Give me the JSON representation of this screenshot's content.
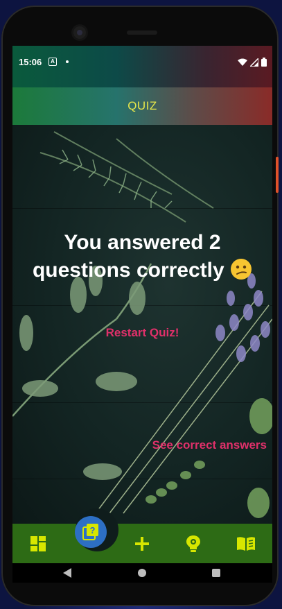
{
  "status_bar": {
    "time": "15:06",
    "notification_icon": "A"
  },
  "app_bar": {
    "title": "QUIZ"
  },
  "result": {
    "message": "You answered 2 questions correctly",
    "emoji_name": "confused-face-emoji"
  },
  "actions": {
    "restart_label": "Restart Quiz!",
    "see_answers_label": "See correct answers"
  },
  "bottom_nav": {
    "items": [
      {
        "icon": "dashboard-icon"
      },
      {
        "icon": "quiz-icon",
        "active": true
      },
      {
        "icon": "plus-icon"
      },
      {
        "icon": "lightbulb-gear-icon"
      },
      {
        "icon": "book-icon"
      }
    ]
  },
  "colors": {
    "accent_pink": "#e0306a",
    "title_yellow": "#e6e64a",
    "nav_green": "#2d6b15",
    "fab_blue": "#2d6fc4",
    "nav_icon_yellow": "#d7e600"
  }
}
